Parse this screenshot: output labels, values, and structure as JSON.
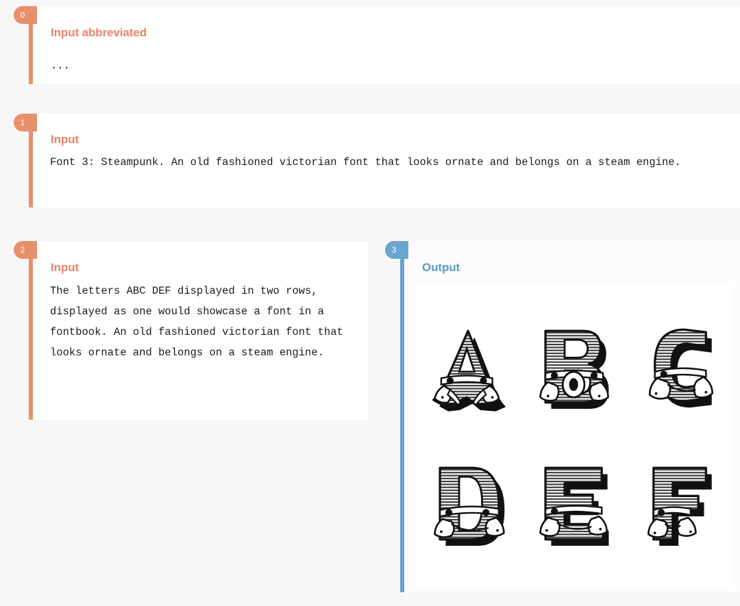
{
  "page": {
    "background": "#f7f7f7",
    "accent_orange": "#e8906b",
    "accent_blue": "#6aa5ce"
  },
  "blocks": [
    {
      "index": "0",
      "heading": "Input abbreviated",
      "role": "input",
      "text": "...",
      "accent": "#e8906b"
    },
    {
      "index": "1",
      "heading": "Input",
      "role": "input",
      "text": "Font 3: Steampunk. An old fashioned victorian font that looks ornate and belongs on a steam engine.",
      "accent": "#e8906b"
    },
    {
      "index": "2",
      "heading": "Input",
      "role": "input",
      "text": "The letters ABC DEF displayed in two rows, displayed as one would showcase a font in a fontbook. An old fashioned victorian font that looks ornate and belongs on a steam engine.",
      "accent": "#e8906b"
    },
    {
      "index": "3",
      "heading": "Output",
      "role": "output",
      "accent": "#6aa5ce"
    }
  ],
  "output_image": {
    "description": "Ornate Victorian / steampunk display letters rendered in black-and-white engraving style with horizontal line hatching, decorative scrollwork feet and rivet dots",
    "rows": [
      [
        "A",
        "B",
        "C"
      ],
      [
        "D",
        "E",
        "F"
      ]
    ],
    "letters": [
      "A",
      "B",
      "C",
      "D",
      "E",
      "F"
    ],
    "style": "black-and-white engraved victorian steampunk",
    "background": "#ffffff"
  }
}
